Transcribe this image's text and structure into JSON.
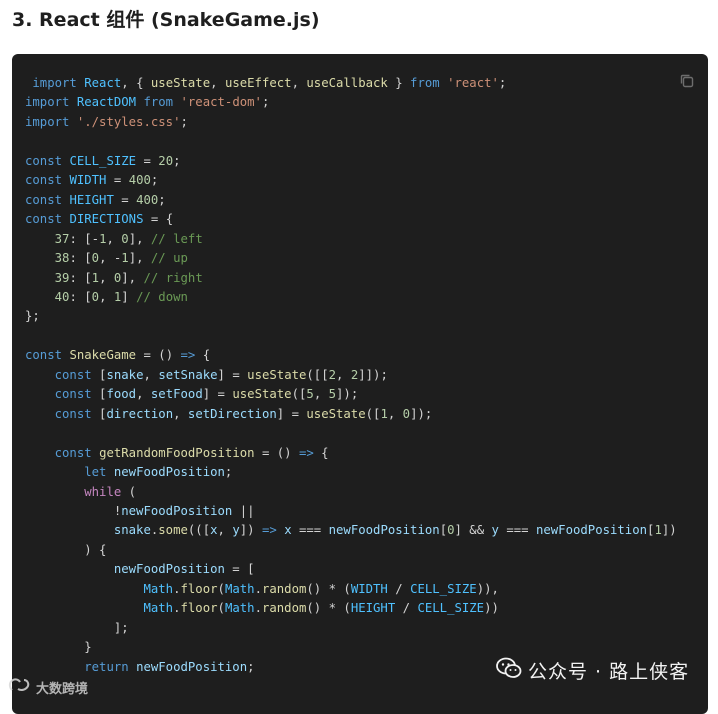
{
  "heading": "3. React 组件 (SnakeGame.js)",
  "code_lines": [
    " import React, { useState, useEffect, useCallback } from 'react';",
    "import ReactDOM from 'react-dom';",
    "import './styles.css';",
    "",
    "const CELL_SIZE = 20;",
    "const WIDTH = 400;",
    "const HEIGHT = 400;",
    "const DIRECTIONS = {",
    "    37: [-1, 0], // left",
    "    38: [0, -1], // up",
    "    39: [1, 0], // right",
    "    40: [0, 1] // down",
    "};",
    "",
    "const SnakeGame = () => {",
    "    const [snake, setSnake] = useState([[2, 2]]);",
    "    const [food, setFood] = useState([5, 5]);",
    "    const [direction, setDirection] = useState([1, 0]);",
    "",
    "    const getRandomFoodPosition = () => {",
    "        let newFoodPosition;",
    "        while (",
    "            !newFoodPosition ||",
    "            snake.some(([x, y]) => x === newFoodPosition[0] && y === newFoodPosition[1])",
    "        ) {",
    "            newFoodPosition = [",
    "                Math.floor(Math.random() * (WIDTH / CELL_SIZE)),",
    "                Math.floor(Math.random() * (HEIGHT / CELL_SIZE))",
    "            ];",
    "        }",
    "        return newFoodPosition;"
  ],
  "watermark_left": "大数跨境",
  "watermark_right": "公众号 · 路上侠客",
  "icons": {
    "copy": "copy-icon",
    "wechat": "wechat-icon",
    "watermark_logo": "logo-icon"
  },
  "colors": {
    "background": "#1e1e1e",
    "keyword": "#569cd6",
    "control_keyword": "#c586c0",
    "string": "#ce9178",
    "number": "#b5cea8",
    "comment": "#6a9955",
    "variable": "#9cdcfe",
    "constant": "#4fc1ff",
    "function": "#dcdcaa",
    "default": "#d4d4d4"
  }
}
